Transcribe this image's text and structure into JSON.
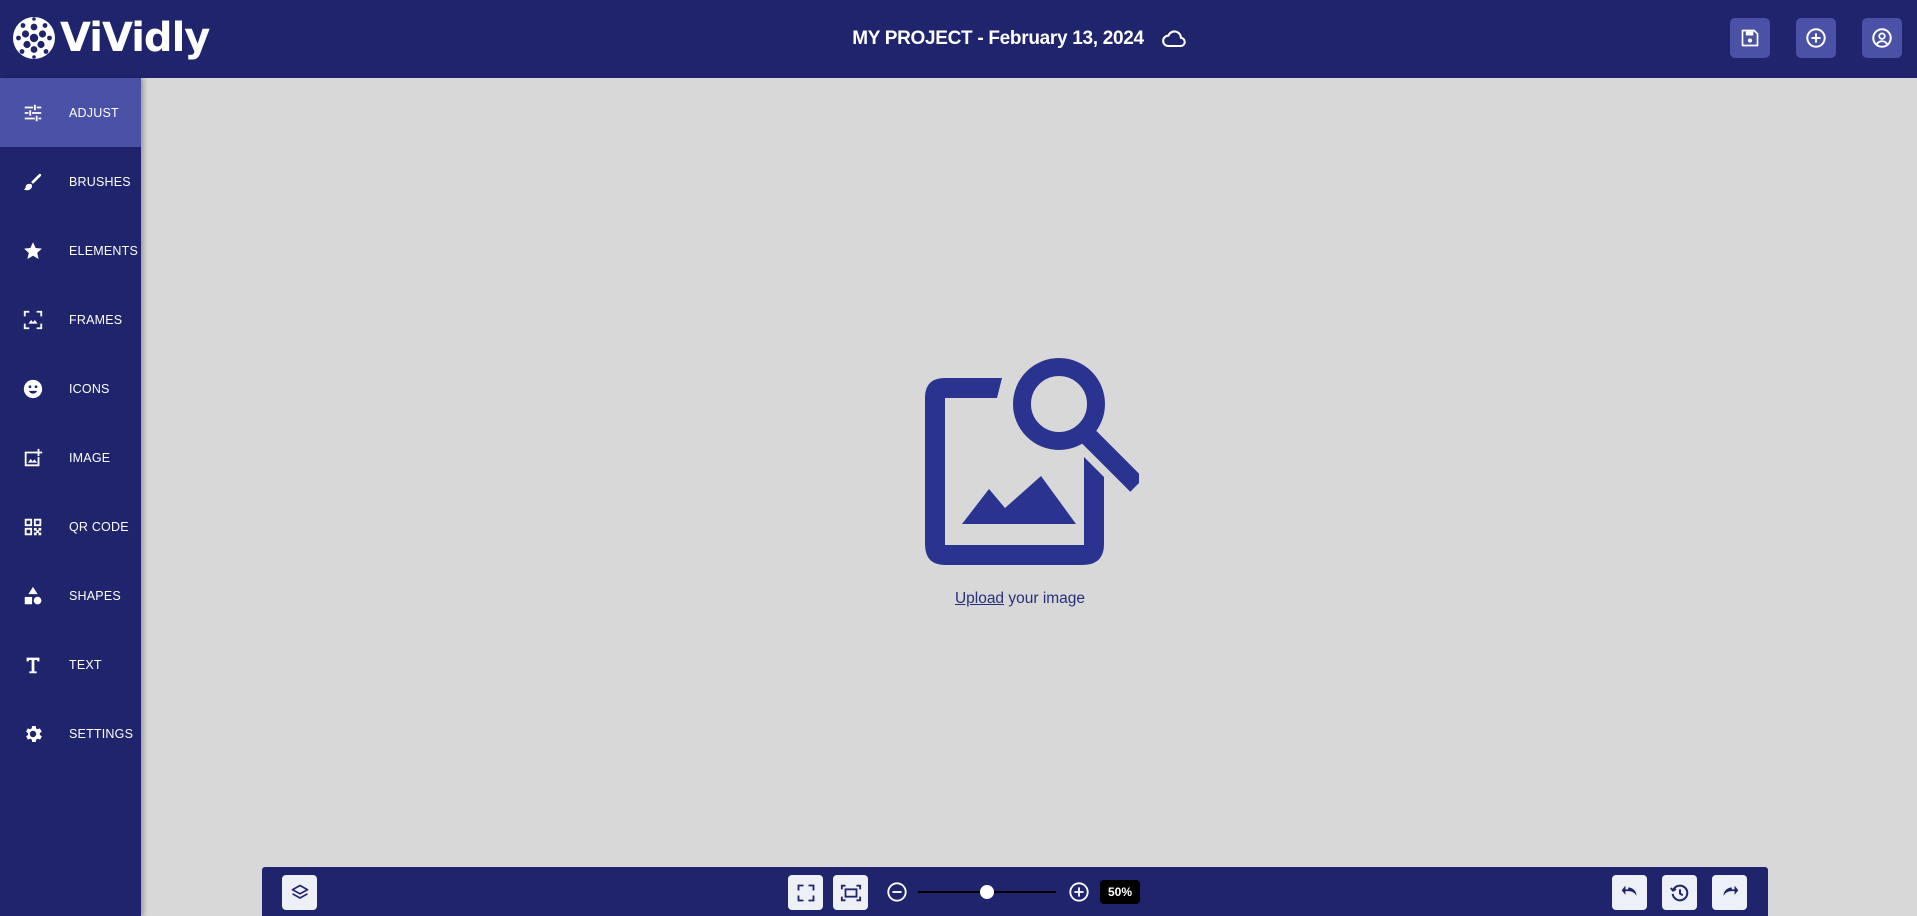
{
  "app": {
    "name": "ViVidly"
  },
  "header": {
    "project_title": "MY PROJECT - February 13, 2024",
    "buttons": [
      {
        "name": "save",
        "icon": "floppy-disk-icon"
      },
      {
        "name": "new",
        "icon": "plus-circle-icon"
      },
      {
        "name": "account",
        "icon": "user-circle-icon"
      }
    ]
  },
  "sidebar": {
    "active": "ADJUST",
    "items": [
      {
        "label": "ADJUST",
        "icon": "sliders-icon"
      },
      {
        "label": "BRUSHES",
        "icon": "brush-icon"
      },
      {
        "label": "ELEMENTS",
        "icon": "star-icon"
      },
      {
        "label": "FRAMES",
        "icon": "frame-icon"
      },
      {
        "label": "ICONS",
        "icon": "smiley-icon"
      },
      {
        "label": "IMAGE",
        "icon": "add-image-icon"
      },
      {
        "label": "QR CODE",
        "icon": "qr-code-icon"
      },
      {
        "label": "SHAPES",
        "icon": "shapes-icon"
      },
      {
        "label": "TEXT",
        "icon": "text-icon"
      },
      {
        "label": "SETTINGS",
        "icon": "gear-icon"
      }
    ]
  },
  "canvas": {
    "upload_link": "Upload",
    "upload_rest": " your image"
  },
  "toolbar": {
    "zoom_label": "50%",
    "zoom_level": 0.5
  },
  "colors": {
    "brand": "#1f246d",
    "active": "#4a51a6",
    "canvas_bg": "#d8d8d8",
    "illustration": "#2a3390"
  }
}
